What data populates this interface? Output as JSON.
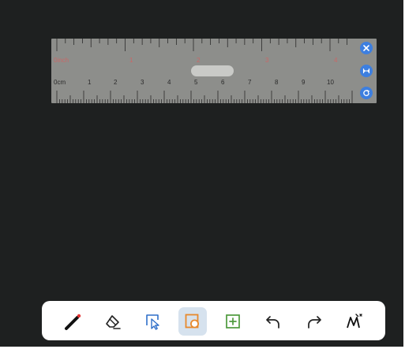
{
  "ruler": {
    "inch_labels": [
      "0inch",
      "1",
      "2",
      "3",
      "4"
    ],
    "cm_labels": [
      "0cm",
      "1",
      "2",
      "3",
      "4",
      "5",
      "6",
      "7",
      "8",
      "9",
      "10"
    ],
    "buttons": [
      {
        "name": "ruler-close-button",
        "icon": "close-icon"
      },
      {
        "name": "ruler-measure-button",
        "icon": "measure-width-icon"
      },
      {
        "name": "ruler-rotate-button",
        "icon": "rotate-icon"
      }
    ]
  },
  "toolbar": {
    "tools": [
      {
        "name": "pen-tool",
        "icon": "pen-icon",
        "active": false
      },
      {
        "name": "eraser-tool",
        "icon": "eraser-icon",
        "active": false
      },
      {
        "name": "select-tool",
        "icon": "select-cursor-icon",
        "active": false
      },
      {
        "name": "shape-tool",
        "icon": "shape-icon",
        "active": true
      },
      {
        "name": "add-tool",
        "icon": "add-box-icon",
        "active": false
      },
      {
        "name": "undo-tool",
        "icon": "undo-icon",
        "active": false
      },
      {
        "name": "redo-tool",
        "icon": "redo-icon",
        "active": false
      },
      {
        "name": "ai-write-tool",
        "icon": "handwriting-icon",
        "active": false
      }
    ]
  },
  "colors": {
    "canvas": "#1e2020",
    "ruler": "#8d8e8b",
    "ruler_button": "#3d7fe0",
    "inch_text": "#c96868",
    "active_tool_bg": "#d6e2ee",
    "shape_orange": "#e8892c",
    "add_green": "#4d9a3c",
    "select_blue": "#2f6fc9"
  }
}
